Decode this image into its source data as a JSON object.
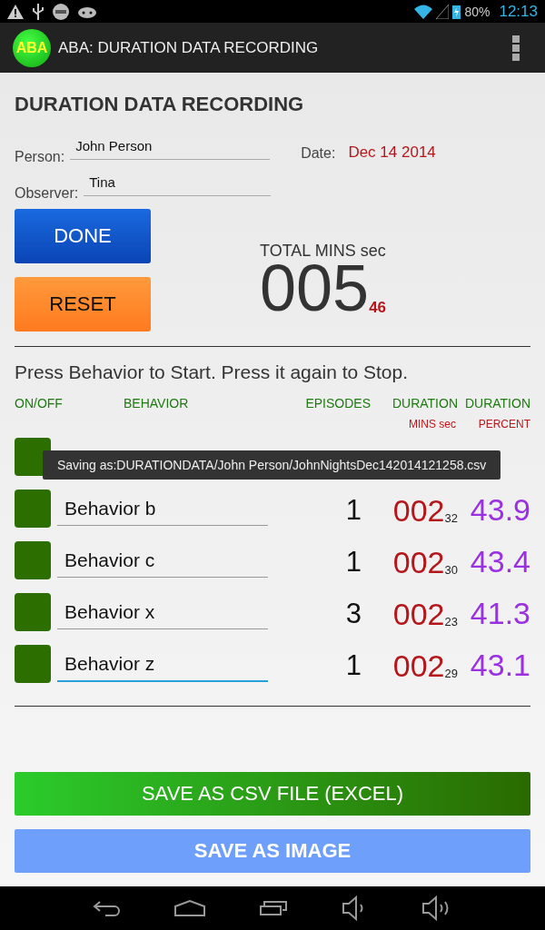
{
  "status_bar": {
    "battery": "80%",
    "time": "12:13"
  },
  "action_bar": {
    "logo": "ABA",
    "title": "ABA: DURATION DATA RECORDING"
  },
  "heading": "DURATION DATA RECORDING",
  "person": {
    "label": "Person:",
    "value": "John Person"
  },
  "date": {
    "label": "Date:",
    "value": "Dec 14 2014"
  },
  "observer": {
    "label": "Observer:",
    "value": "Tina"
  },
  "buttons": {
    "done": "DONE",
    "reset": "RESET"
  },
  "total": {
    "label": "TOTAL MINS sec",
    "mins": "005",
    "sec": "46"
  },
  "instructions": "Press Behavior to Start. Press it again to Stop.",
  "columns": [
    {
      "label": "ON/OFF"
    },
    {
      "label": "BEHAVIOR"
    },
    {
      "label": "EPISODES"
    },
    {
      "label": "DURATION",
      "sub": "MINS sec"
    },
    {
      "label": "DURATION",
      "sub": "PERCENT"
    }
  ],
  "rows": [
    {
      "on": false
    },
    {
      "on": false,
      "behavior": "Behavior b",
      "episodes": "1",
      "mins": "002",
      "sec": "32",
      "percent": "43.9",
      "focused": false
    },
    {
      "on": false,
      "behavior": "Behavior c",
      "episodes": "1",
      "mins": "002",
      "sec": "30",
      "percent": "43.4",
      "focused": false
    },
    {
      "on": false,
      "behavior": "Behavior x",
      "episodes": "3",
      "mins": "002",
      "sec": "23",
      "percent": "41.3",
      "focused": false
    },
    {
      "on": false,
      "behavior": "Behavior z",
      "episodes": "1",
      "mins": "002",
      "sec": "29",
      "percent": "43.1",
      "focused": true
    }
  ],
  "toast": "Saving as:DURATIONDATA/John Person/JohnNightsDec142014121258.csv",
  "save_csv": "SAVE AS CSV FILE (EXCEL)",
  "save_image": "SAVE AS IMAGE"
}
